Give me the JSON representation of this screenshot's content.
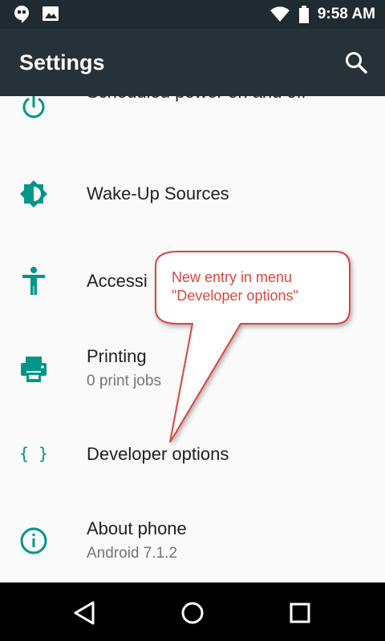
{
  "status_bar": {
    "time": "9:58 AM",
    "icons": [
      "hangouts-notification-icon",
      "image-notification-icon",
      "wifi-icon",
      "battery-icon"
    ]
  },
  "app_bar": {
    "title": "Settings",
    "search_icon": "search-icon"
  },
  "settings_items": [
    {
      "title": "Scheduled power on and off",
      "summary": "",
      "icon": "power-icon"
    },
    {
      "title": "Wake-Up Sources",
      "summary": "",
      "icon": "brightness-icon"
    },
    {
      "title": "Accessi",
      "summary": "",
      "icon": "accessibility-icon"
    },
    {
      "title": "Printing",
      "summary": "0 print jobs",
      "icon": "printer-icon"
    },
    {
      "title": "Developer options",
      "summary": "",
      "icon": "braces-icon"
    },
    {
      "title": "About phone",
      "summary": "Android 7.1.2",
      "icon": "info-icon"
    }
  ],
  "annotation": {
    "line1": "New entry in menu",
    "line2": "\"Developer options\""
  },
  "navigation_bar": {
    "buttons": [
      "back-icon",
      "home-icon",
      "recents-icon"
    ]
  },
  "colors": {
    "status_bar": "#1f2b31",
    "app_bar": "#263238",
    "accent": "#009688",
    "background": "#fafafa",
    "callout_border": "#d8473d",
    "callout_text": "#d8473d"
  }
}
